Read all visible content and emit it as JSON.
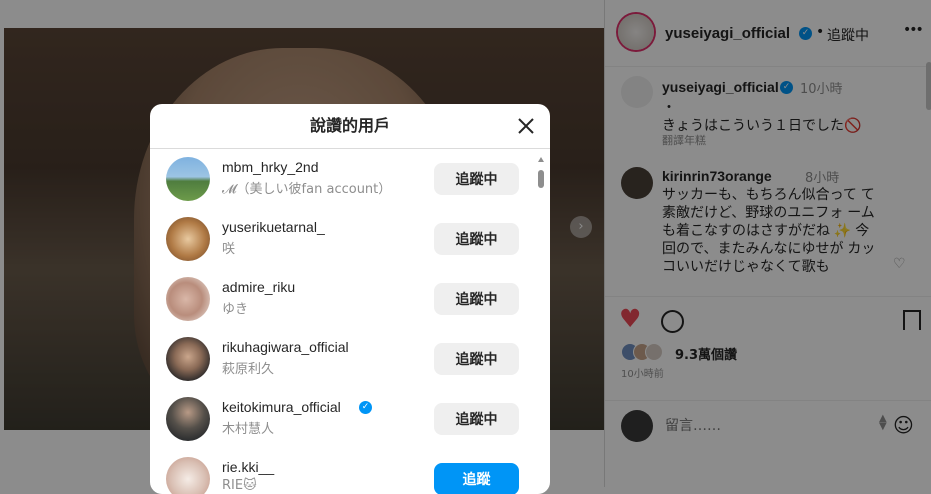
{
  "post": {
    "username": "yuseiyagi_official",
    "follow_status": "追蹤中",
    "more": "•••"
  },
  "caption": {
    "username": "yuseiyagi_official",
    "time": "10小時",
    "dot": "・",
    "text": "きょうはこういう１日でした🚫",
    "translate": "翻譯年糕"
  },
  "comment": {
    "username": "kirinrin73orange",
    "time": "8小時",
    "text": "サッカーも、もちろん似合って て素敵だけど、野球のユニフォ ームも着こなすのはさすがだね ✨ 今回ので、またみんなにゆせが カッコいいだけじゃなくて歌も"
  },
  "actions": {
    "likes": "9.3萬個讚",
    "posted": "10小時前"
  },
  "add_comment": {
    "placeholder": "留言……"
  },
  "modal": {
    "title": "說讚的用戶",
    "users": [
      {
        "username": "mbm_hrky_2nd",
        "display": "𝓜（美しい彼fan account）",
        "button": "追蹤中",
        "following": true
      },
      {
        "username": "yuserikuetarnal_",
        "display": "咲",
        "button": "追蹤中",
        "following": true
      },
      {
        "username": "admire_riku",
        "display": "ゆき",
        "button": "追蹤中",
        "following": true
      },
      {
        "username": "rikuhagiwara_official",
        "display": "萩原利久",
        "button": "追蹤中",
        "following": true
      },
      {
        "username": "keitokimura_official",
        "display": "木村慧人",
        "button": "追蹤中",
        "following": true,
        "verified": true
      },
      {
        "username": "rie.kki__",
        "display": "RIE🐱",
        "button": "追蹤",
        "following": false
      }
    ]
  },
  "colors": {
    "accent": "#0095f6",
    "like": "#ed4956"
  }
}
